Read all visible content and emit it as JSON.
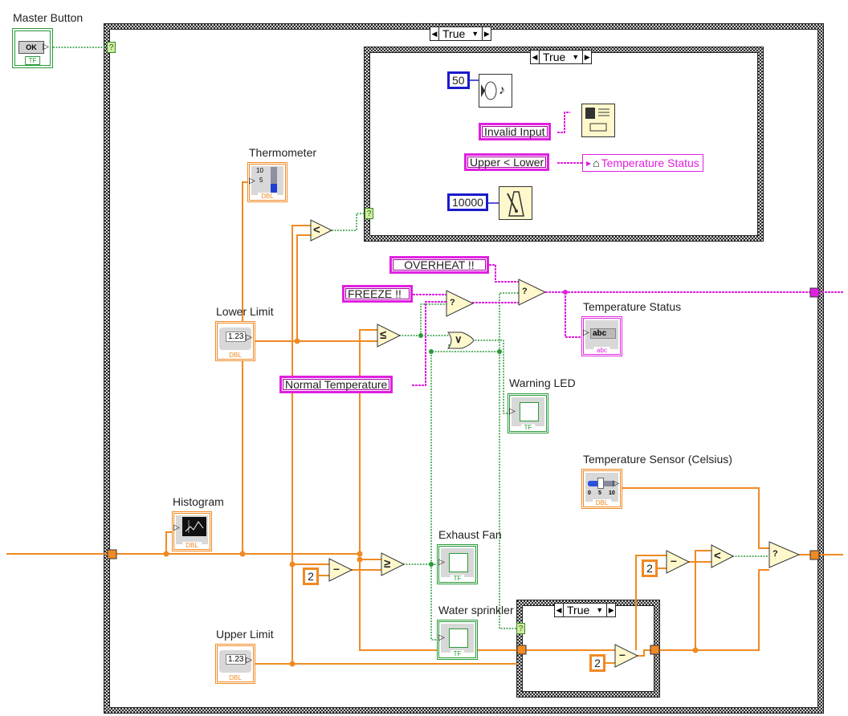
{
  "diagram": {
    "type": "LabVIEW block diagram",
    "colors": {
      "numeric_wire": "#f08a24",
      "boolean_wire": "#2a9a3a",
      "string_wire": "#e020e0",
      "integer_const": "#1a1acc",
      "structure_border": "#444444",
      "function_fill": "#fff8cc"
    },
    "outer_case": {
      "selector_value": "True"
    },
    "inner_case_top": {
      "selector_value": "True"
    },
    "inner_case_bottom": {
      "selector_value": "True"
    },
    "controls": {
      "master_button": {
        "label": "Master Button",
        "button_text": "OK",
        "type_tag": "TF"
      },
      "lower_limit": {
        "label": "Lower Limit",
        "value": "1.23",
        "type_tag": "DBL"
      },
      "upper_limit": {
        "label": "Upper Limit",
        "value": "1.23",
        "type_tag": "DBL"
      },
      "temperature_sensor": {
        "label": "Temperature Sensor (Celsius)",
        "ticks": [
          "0",
          "5",
          "10"
        ],
        "type_tag": "DBL"
      }
    },
    "indicators": {
      "thermometer": {
        "label": "Thermometer",
        "ticks": [
          "10",
          "5"
        ],
        "type_tag": "DBL"
      },
      "histogram": {
        "label": "Histogram",
        "type_tag": "DBL"
      },
      "temperature_status": {
        "label": "Temperature Status",
        "value": "abc",
        "type_tag": "abc"
      },
      "warning_led": {
        "label": "Warning LED",
        "type_tag": "TF"
      },
      "exhaust_fan": {
        "label": "Exhaust Fan",
        "type_tag": "TF"
      },
      "water_sprinkler": {
        "label": "Water sprinkler",
        "type_tag": "TF"
      }
    },
    "constants": {
      "beep_freq": "50",
      "wait_ms": "10000",
      "invalid_input": "Invalid Input",
      "upper_lower": "Upper < Lower",
      "overheat": "OVERHEAT !!",
      "freeze": "FREEZE !!",
      "normal_temp": "Normal Temperature",
      "two_a": "2",
      "two_b": "2",
      "two_c": "2"
    },
    "local_variable": {
      "label": "Temperature Status"
    },
    "functions": {
      "less_than": "<",
      "less_equal": "≤",
      "greater_equal": "≥",
      "or": "∨",
      "subtract": "–",
      "select": "?",
      "selector_terminal": "?"
    }
  }
}
